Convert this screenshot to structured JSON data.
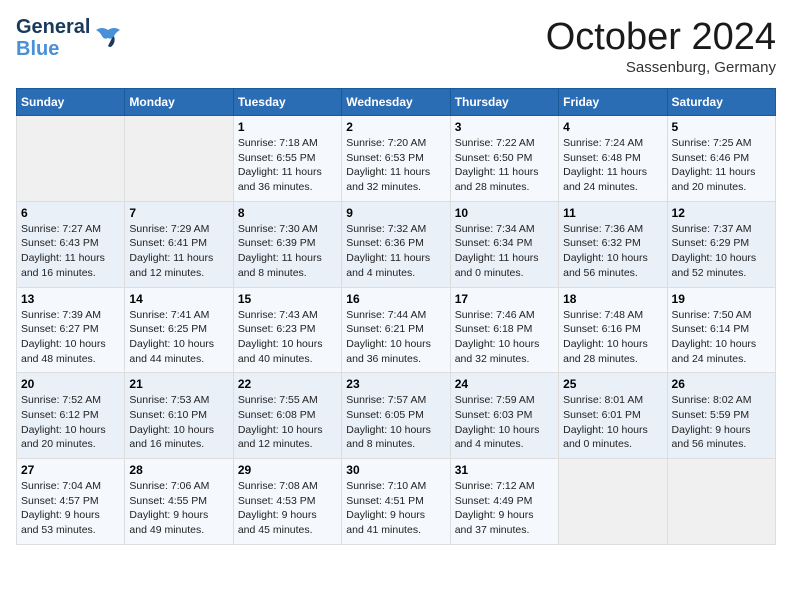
{
  "logo": {
    "line1": "General",
    "line2": "Blue"
  },
  "title": "October 2024",
  "location": "Sassenburg, Germany",
  "weekdays": [
    "Sunday",
    "Monday",
    "Tuesday",
    "Wednesday",
    "Thursday",
    "Friday",
    "Saturday"
  ],
  "weeks": [
    [
      {
        "day": "",
        "info": ""
      },
      {
        "day": "",
        "info": ""
      },
      {
        "day": "1",
        "info": "Sunrise: 7:18 AM\nSunset: 6:55 PM\nDaylight: 11 hours\nand 36 minutes."
      },
      {
        "day": "2",
        "info": "Sunrise: 7:20 AM\nSunset: 6:53 PM\nDaylight: 11 hours\nand 32 minutes."
      },
      {
        "day": "3",
        "info": "Sunrise: 7:22 AM\nSunset: 6:50 PM\nDaylight: 11 hours\nand 28 minutes."
      },
      {
        "day": "4",
        "info": "Sunrise: 7:24 AM\nSunset: 6:48 PM\nDaylight: 11 hours\nand 24 minutes."
      },
      {
        "day": "5",
        "info": "Sunrise: 7:25 AM\nSunset: 6:46 PM\nDaylight: 11 hours\nand 20 minutes."
      }
    ],
    [
      {
        "day": "6",
        "info": "Sunrise: 7:27 AM\nSunset: 6:43 PM\nDaylight: 11 hours\nand 16 minutes."
      },
      {
        "day": "7",
        "info": "Sunrise: 7:29 AM\nSunset: 6:41 PM\nDaylight: 11 hours\nand 12 minutes."
      },
      {
        "day": "8",
        "info": "Sunrise: 7:30 AM\nSunset: 6:39 PM\nDaylight: 11 hours\nand 8 minutes."
      },
      {
        "day": "9",
        "info": "Sunrise: 7:32 AM\nSunset: 6:36 PM\nDaylight: 11 hours\nand 4 minutes."
      },
      {
        "day": "10",
        "info": "Sunrise: 7:34 AM\nSunset: 6:34 PM\nDaylight: 11 hours\nand 0 minutes."
      },
      {
        "day": "11",
        "info": "Sunrise: 7:36 AM\nSunset: 6:32 PM\nDaylight: 10 hours\nand 56 minutes."
      },
      {
        "day": "12",
        "info": "Sunrise: 7:37 AM\nSunset: 6:29 PM\nDaylight: 10 hours\nand 52 minutes."
      }
    ],
    [
      {
        "day": "13",
        "info": "Sunrise: 7:39 AM\nSunset: 6:27 PM\nDaylight: 10 hours\nand 48 minutes."
      },
      {
        "day": "14",
        "info": "Sunrise: 7:41 AM\nSunset: 6:25 PM\nDaylight: 10 hours\nand 44 minutes."
      },
      {
        "day": "15",
        "info": "Sunrise: 7:43 AM\nSunset: 6:23 PM\nDaylight: 10 hours\nand 40 minutes."
      },
      {
        "day": "16",
        "info": "Sunrise: 7:44 AM\nSunset: 6:21 PM\nDaylight: 10 hours\nand 36 minutes."
      },
      {
        "day": "17",
        "info": "Sunrise: 7:46 AM\nSunset: 6:18 PM\nDaylight: 10 hours\nand 32 minutes."
      },
      {
        "day": "18",
        "info": "Sunrise: 7:48 AM\nSunset: 6:16 PM\nDaylight: 10 hours\nand 28 minutes."
      },
      {
        "day": "19",
        "info": "Sunrise: 7:50 AM\nSunset: 6:14 PM\nDaylight: 10 hours\nand 24 minutes."
      }
    ],
    [
      {
        "day": "20",
        "info": "Sunrise: 7:52 AM\nSunset: 6:12 PM\nDaylight: 10 hours\nand 20 minutes."
      },
      {
        "day": "21",
        "info": "Sunrise: 7:53 AM\nSunset: 6:10 PM\nDaylight: 10 hours\nand 16 minutes."
      },
      {
        "day": "22",
        "info": "Sunrise: 7:55 AM\nSunset: 6:08 PM\nDaylight: 10 hours\nand 12 minutes."
      },
      {
        "day": "23",
        "info": "Sunrise: 7:57 AM\nSunset: 6:05 PM\nDaylight: 10 hours\nand 8 minutes."
      },
      {
        "day": "24",
        "info": "Sunrise: 7:59 AM\nSunset: 6:03 PM\nDaylight: 10 hours\nand 4 minutes."
      },
      {
        "day": "25",
        "info": "Sunrise: 8:01 AM\nSunset: 6:01 PM\nDaylight: 10 hours\nand 0 minutes."
      },
      {
        "day": "26",
        "info": "Sunrise: 8:02 AM\nSunset: 5:59 PM\nDaylight: 9 hours\nand 56 minutes."
      }
    ],
    [
      {
        "day": "27",
        "info": "Sunrise: 7:04 AM\nSunset: 4:57 PM\nDaylight: 9 hours\nand 53 minutes."
      },
      {
        "day": "28",
        "info": "Sunrise: 7:06 AM\nSunset: 4:55 PM\nDaylight: 9 hours\nand 49 minutes."
      },
      {
        "day": "29",
        "info": "Sunrise: 7:08 AM\nSunset: 4:53 PM\nDaylight: 9 hours\nand 45 minutes."
      },
      {
        "day": "30",
        "info": "Sunrise: 7:10 AM\nSunset: 4:51 PM\nDaylight: 9 hours\nand 41 minutes."
      },
      {
        "day": "31",
        "info": "Sunrise: 7:12 AM\nSunset: 4:49 PM\nDaylight: 9 hours\nand 37 minutes."
      },
      {
        "day": "",
        "info": ""
      },
      {
        "day": "",
        "info": ""
      }
    ]
  ]
}
